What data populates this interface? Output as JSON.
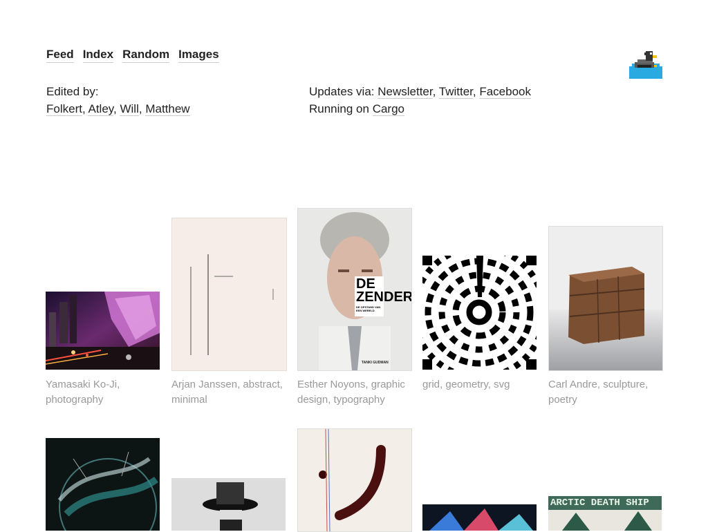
{
  "nav": {
    "items": [
      {
        "label": "Feed"
      },
      {
        "label": "Index"
      },
      {
        "label": "Random"
      },
      {
        "label": "Images"
      }
    ]
  },
  "editors": {
    "heading": "Edited by:",
    "names": [
      "Folkert",
      "Atley",
      "Will",
      "Matthew"
    ]
  },
  "updates": {
    "prefix": "Updates via:",
    "links": [
      "Newsletter",
      "Twitter",
      "Facebook"
    ],
    "running_prefix": "Running on ",
    "running_link": "Cargo"
  },
  "logo_icon": "duck-pixel-icon",
  "posts": [
    {
      "tags": [
        "Yamasaki Ko-Ji",
        "photography"
      ]
    },
    {
      "tags": [
        "Arjan Janssen",
        "abstract",
        "minimal"
      ]
    },
    {
      "tags": [
        "Esther Noyons",
        "graphic design",
        "typography"
      ],
      "poster_title": "DE ZENDER",
      "poster_sub": "DE OPSTAND VAN EEN WERELD",
      "poster_footer": "TANKI GUDMAN"
    },
    {
      "tags": [
        "grid",
        "geometry",
        "svg"
      ]
    },
    {
      "tags": [
        "Carl Andre",
        "sculpture",
        "poetry"
      ]
    },
    {
      "tags": []
    },
    {
      "tags": []
    },
    {
      "tags": []
    },
    {
      "tags": []
    },
    {
      "tags": [],
      "poster_title": "ARCTIC DEATH SHIP"
    }
  ]
}
